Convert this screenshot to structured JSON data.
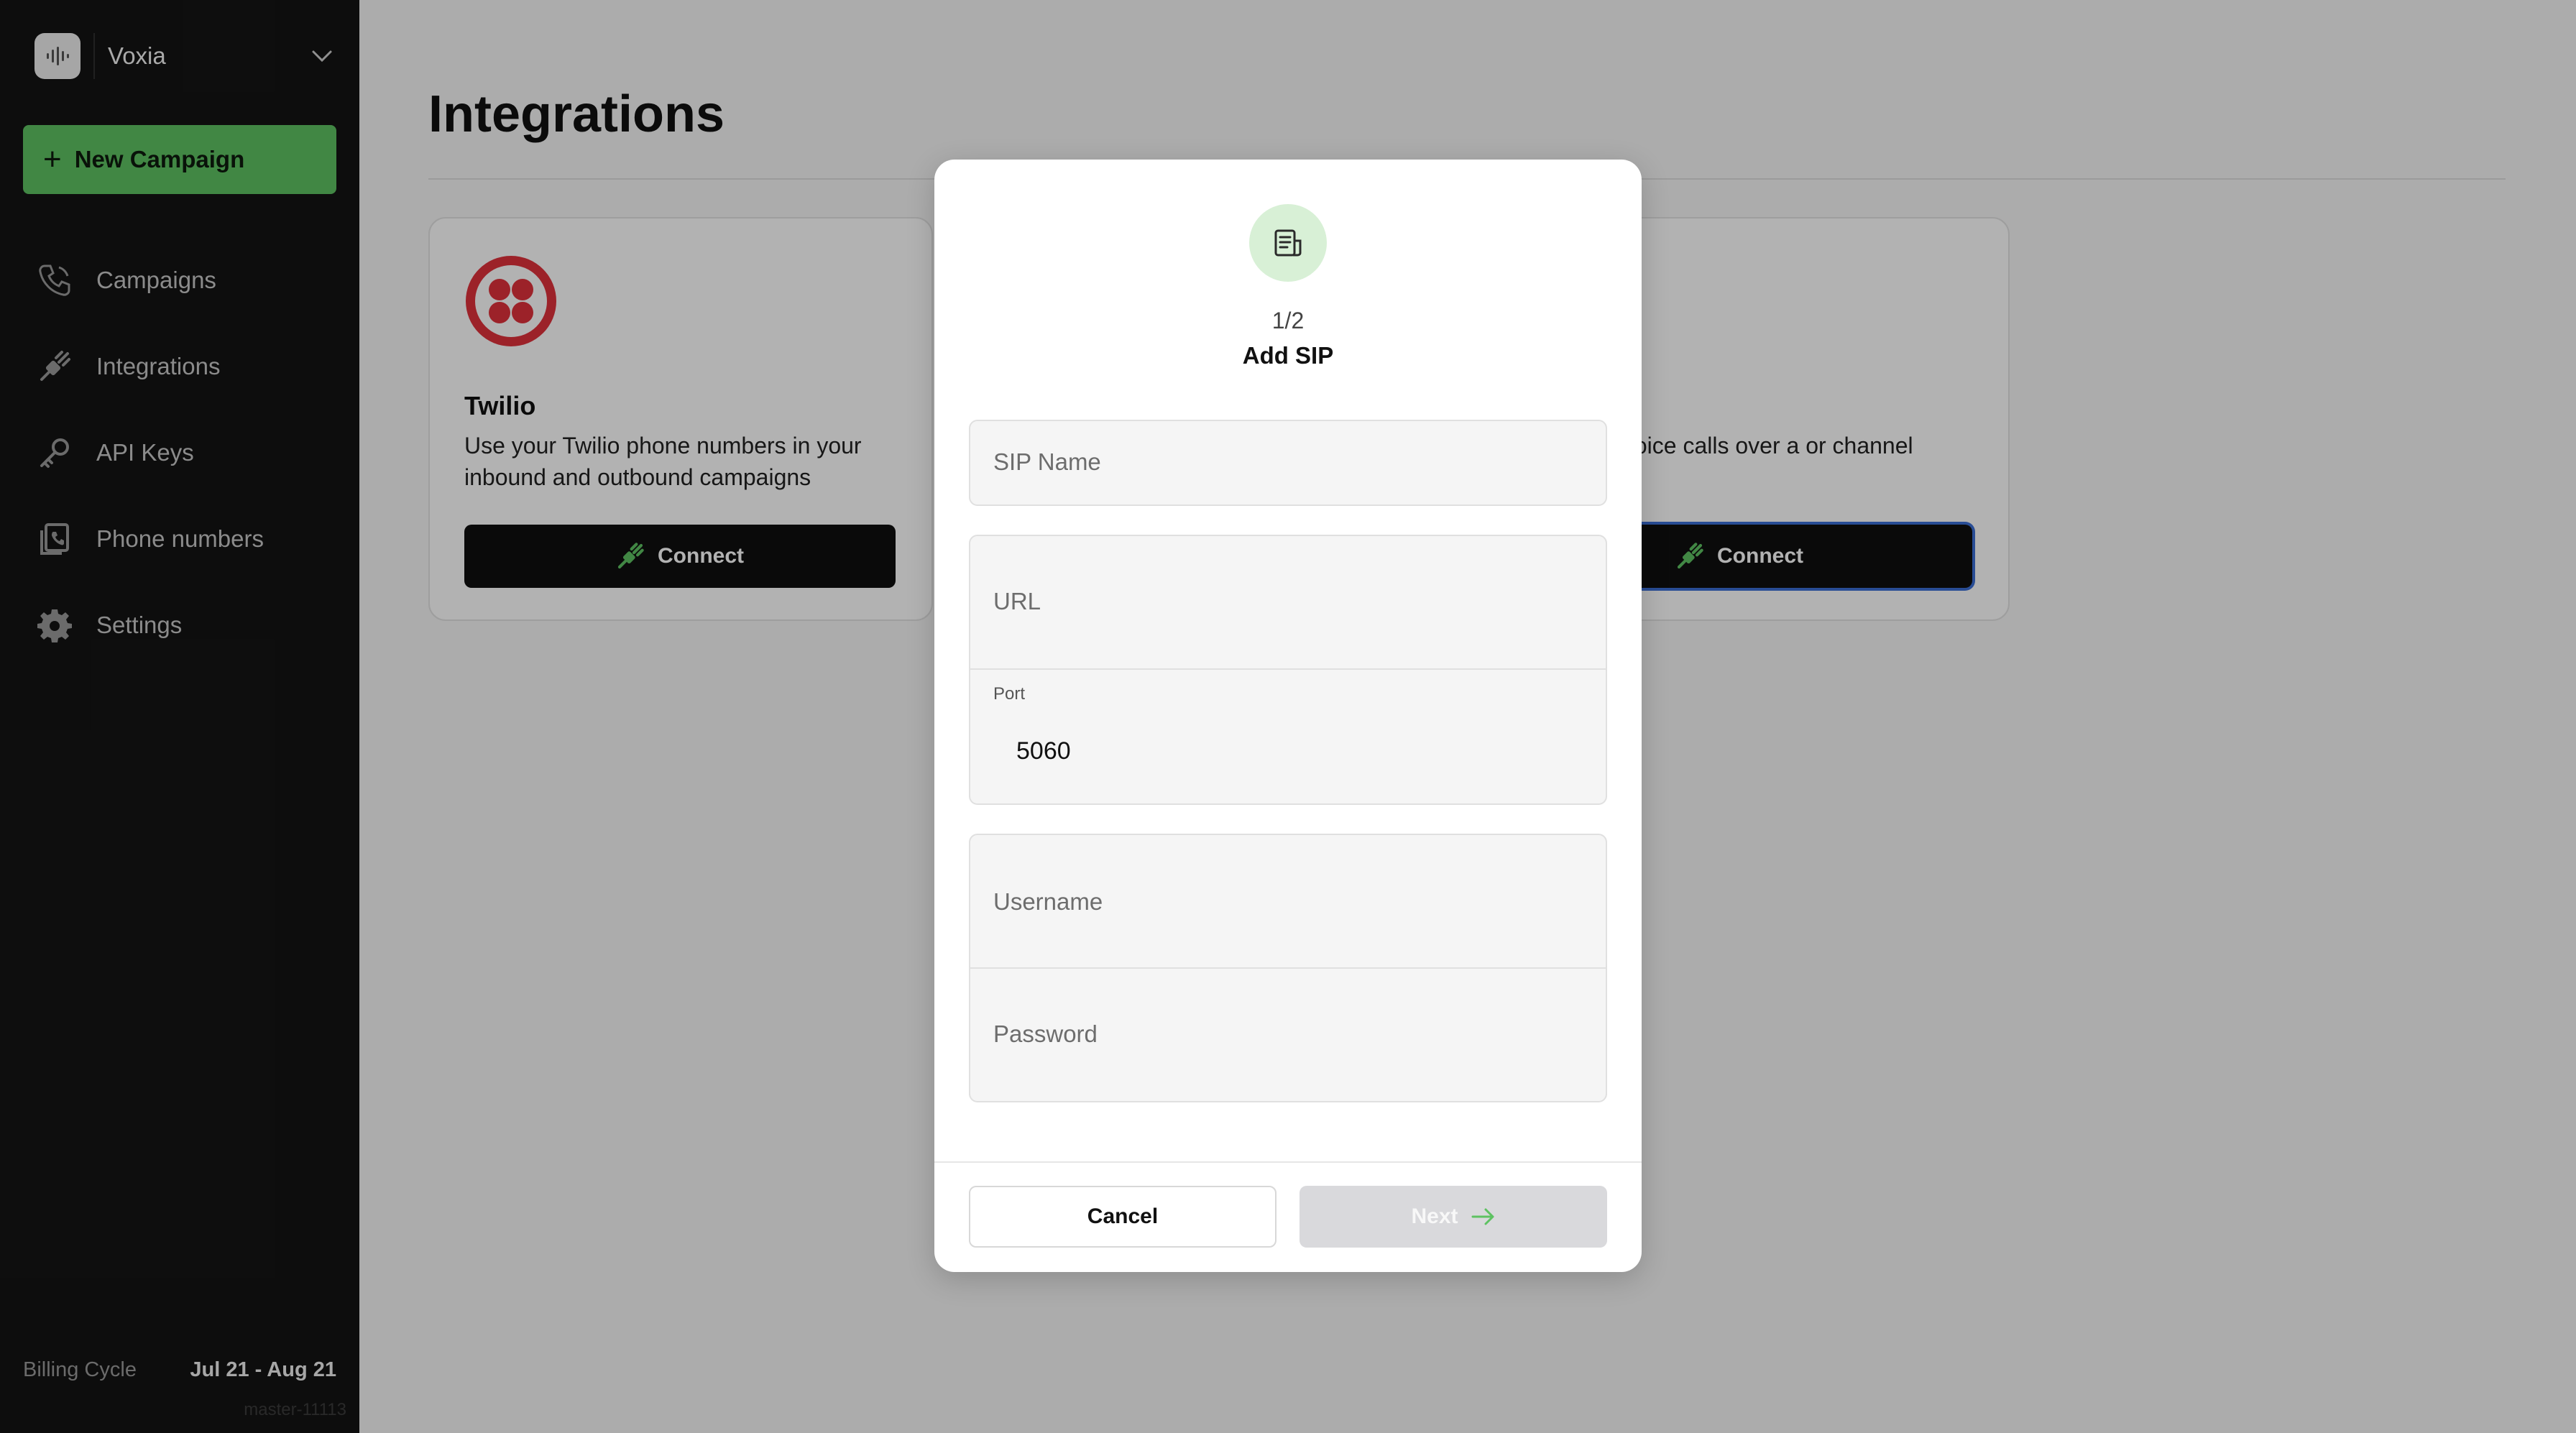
{
  "brand": {
    "name": "Voxia"
  },
  "sidebar": {
    "new_campaign_label": "New Campaign",
    "items": [
      {
        "label": "Campaigns",
        "icon": "phone-icon"
      },
      {
        "label": "Integrations",
        "icon": "plug-icon"
      },
      {
        "label": "API Keys",
        "icon": "key-icon"
      },
      {
        "label": "Phone numbers",
        "icon": "phone-book-icon"
      },
      {
        "label": "Settings",
        "icon": "gear-icon"
      }
    ],
    "billing_label": "Billing Cycle",
    "billing_value": "Jul 21 - Aug 21",
    "version": "master-11113"
  },
  "main": {
    "title": "Integrations",
    "cards": [
      {
        "name": "Twilio",
        "description": "Use your Twilio phone numbers in your inbound and outbound campaigns",
        "button_label": "Connect"
      },
      {
        "name": "",
        "description": "nd transfer voice calls over a or channel",
        "button_label": "Connect"
      }
    ]
  },
  "modal": {
    "step": "1/2",
    "title": "Add SIP",
    "fields": {
      "sip_name_placeholder": "SIP Name",
      "url_placeholder": "URL",
      "port_label": "Port",
      "port_value": "5060",
      "username_placeholder": "Username",
      "password_placeholder": "Password"
    },
    "cancel_label": "Cancel",
    "next_label": "Next"
  },
  "colors": {
    "sidebar_bg": "#141414",
    "accent_green": "#5ec262",
    "twilio_red": "#e0313b",
    "focus_blue": "#3b6fd6"
  }
}
